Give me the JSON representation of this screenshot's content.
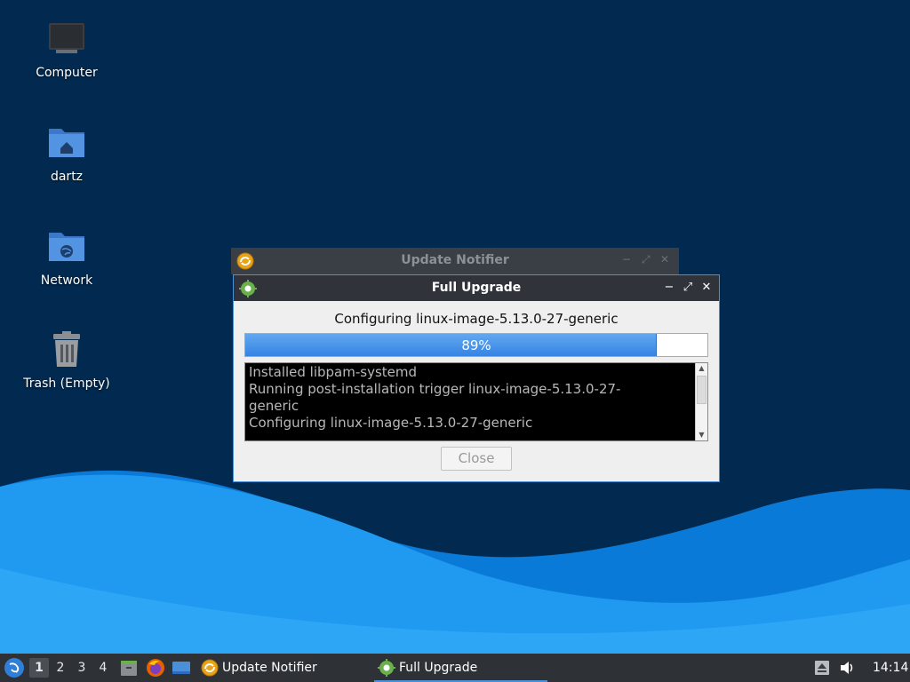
{
  "desktop": {
    "icons": [
      {
        "label": "Computer",
        "icon": "computer-icon"
      },
      {
        "label": "dartz",
        "icon": "home-folder-icon"
      },
      {
        "label": "Network",
        "icon": "network-folder-icon"
      },
      {
        "label": "Trash (Empty)",
        "icon": "trash-icon"
      }
    ]
  },
  "background_window": {
    "title": "Update Notifier",
    "icon": "update-notifier-icon"
  },
  "dialog": {
    "title": "Full Upgrade",
    "icon": "gear-icon",
    "minimize": "−",
    "maximize": "⤢",
    "close": "✕",
    "status": "Configuring linux-image-5.13.0-27-generic",
    "progress_fraction": 0.89,
    "progress_label": "89%",
    "log_lines": [
      "Installed libpam-systemd",
      "Running post-installation trigger linux-image-5.13.0-27-",
      "generic",
      "Configuring linux-image-5.13.0-27-generic"
    ],
    "close_button": "Close"
  },
  "taskbar": {
    "workspaces": [
      "1",
      "2",
      "3",
      "4"
    ],
    "active_workspace": "1",
    "tasks": [
      {
        "label": "Update Notifier",
        "icon": "update-notifier-icon",
        "active": false
      },
      {
        "label": "Full Upgrade",
        "icon": "gear-icon",
        "active": true
      }
    ],
    "clock": "14:14"
  },
  "colors": {
    "desktop_bg": "#022a50",
    "wave_light": "#1f9af0",
    "wave_mid": "#0a7ad8",
    "accent": "#4a90d9",
    "progress": "#3584e4",
    "taskbar_bg": "#2e3135"
  }
}
